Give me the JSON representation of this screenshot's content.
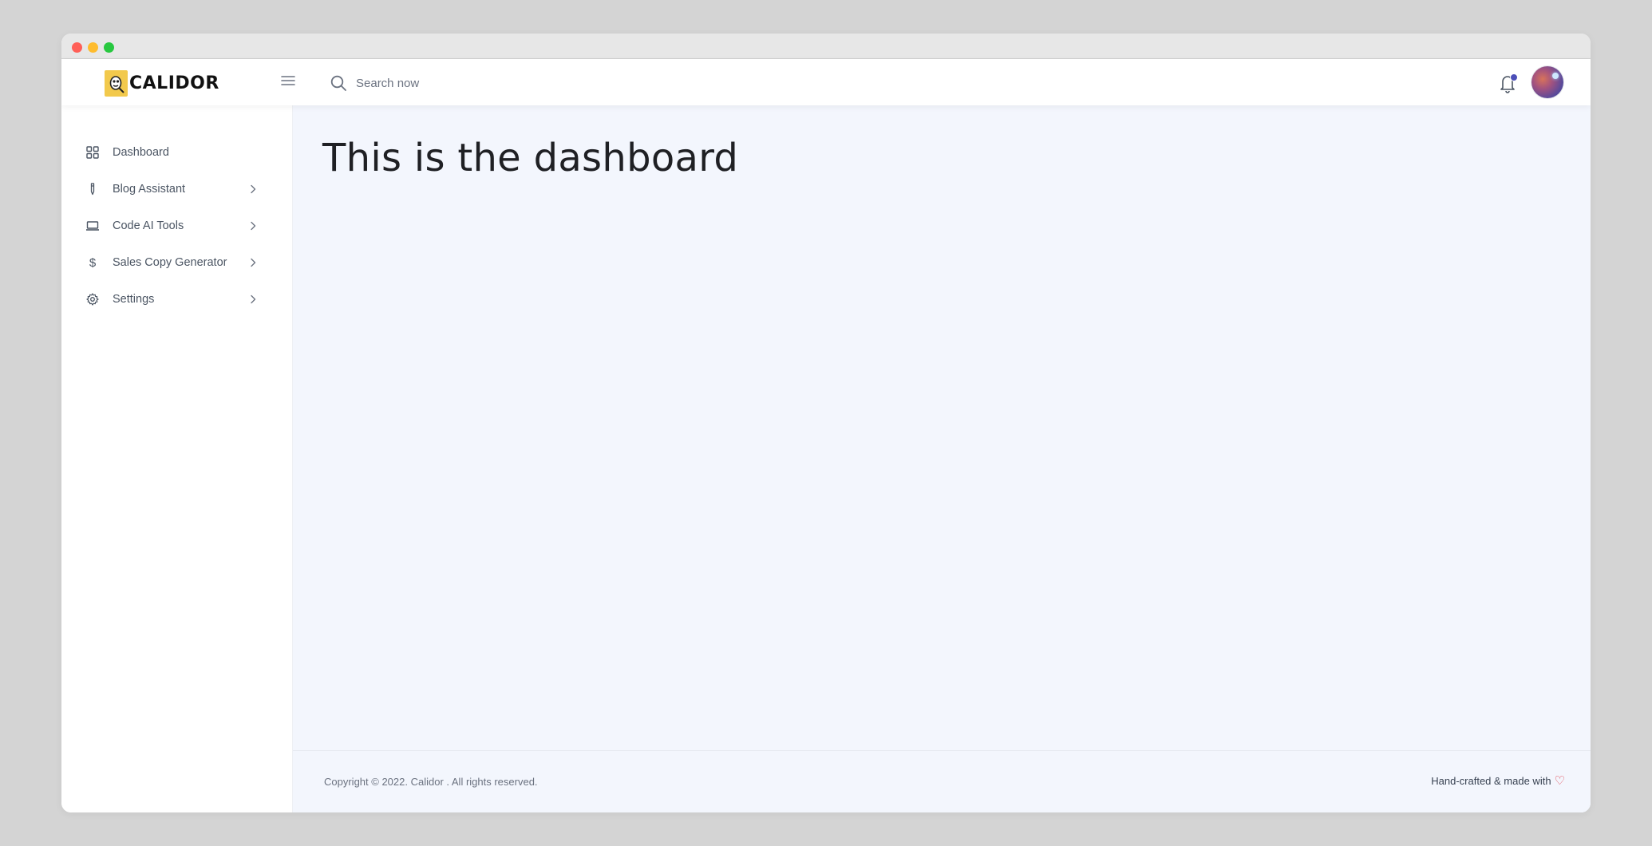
{
  "app": {
    "brand": "CALIDOR"
  },
  "topbar": {
    "search": {
      "placeholder": "Search now",
      "icon": "search-icon"
    },
    "menu_icon": "hamburger-icon",
    "notifications": {
      "icon": "bell-icon",
      "has_unread": true
    },
    "avatar": "user-avatar"
  },
  "sidebar": {
    "items": [
      {
        "label": "Dashboard",
        "icon": "grid-icon",
        "has_submenu": false
      },
      {
        "label": "Blog Assistant",
        "icon": "pen-icon",
        "has_submenu": true
      },
      {
        "label": "Code AI Tools",
        "icon": "laptop-icon",
        "has_submenu": true
      },
      {
        "label": "Sales Copy Generator",
        "icon": "dollar-icon",
        "has_submenu": true
      },
      {
        "label": "Settings",
        "icon": "gear-icon",
        "has_submenu": true
      }
    ]
  },
  "main": {
    "title": "This is the dashboard"
  },
  "footer": {
    "copyright": "Copyright © 2022. Calidor . All rights reserved.",
    "handcrafted": "Hand-crafted & made with",
    "heart": "♡"
  },
  "colors": {
    "accent": "#4c4fb8",
    "logo_bg": "#f2c94c",
    "main_bg": "#f3f6fd",
    "heart": "#e0414d"
  }
}
